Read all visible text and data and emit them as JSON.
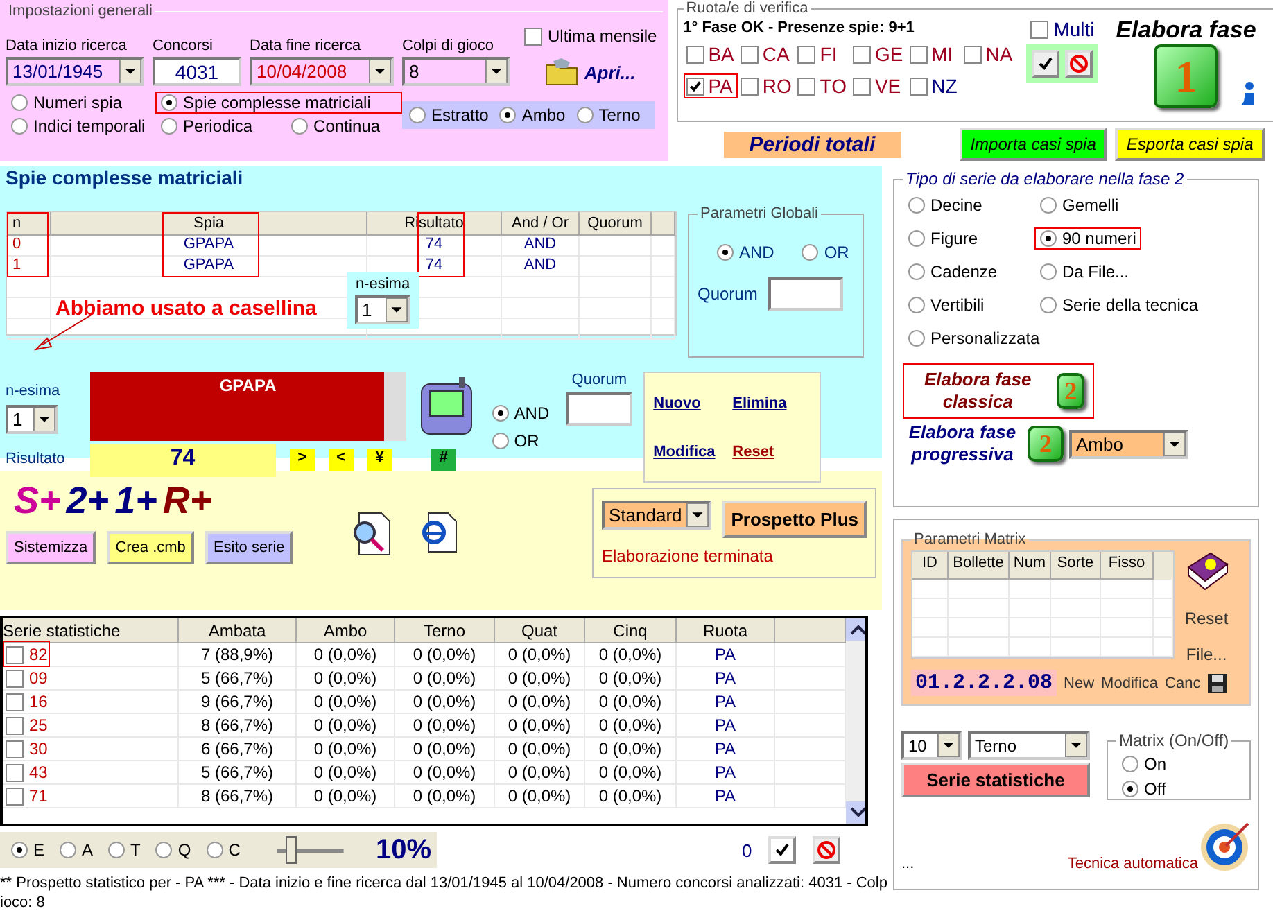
{
  "general": {
    "title": "Impostazioni generali",
    "fields": [
      {
        "label": "Data inizio ricerca",
        "value": "13/01/1945",
        "kind": "combo",
        "color": "#000080"
      },
      {
        "label": "Concorsi",
        "value": "4031",
        "kind": "text",
        "color": "#000080"
      },
      {
        "label": "Data fine ricerca",
        "value": "10/04/2008",
        "kind": "combo",
        "color": "#cc0000"
      },
      {
        "label": "Colpi di gioco",
        "value": "8",
        "kind": "combo",
        "color": "#000000"
      }
    ],
    "ultima_mensile": {
      "label": "Ultima mensile",
      "checked": false
    },
    "open_button": "Apri...",
    "modes": [
      {
        "label": "Numeri spia",
        "selected": false,
        "highlighted": false
      },
      {
        "label": "Spie complesse matriciali",
        "selected": true,
        "highlighted": true
      },
      {
        "label": "Indici temporali",
        "selected": false,
        "highlighted": false
      },
      {
        "label": "Periodica",
        "selected": false,
        "highlighted": false
      },
      {
        "label": "Continua",
        "selected": false,
        "highlighted": false
      }
    ],
    "sorte": [
      {
        "label": "Estratto",
        "selected": false
      },
      {
        "label": "Ambo",
        "selected": true
      },
      {
        "label": "Terno",
        "selected": false
      }
    ]
  },
  "verifica": {
    "title": "Ruota/e di verifica",
    "status": "1° Fase OK - Presenze spie: 9+1",
    "wheels": [
      {
        "label": "BA",
        "checked": false,
        "highlighted": false,
        "color": "#a00020"
      },
      {
        "label": "CA",
        "checked": false,
        "highlighted": false,
        "color": "#a00020"
      },
      {
        "label": "FI",
        "checked": false,
        "highlighted": false,
        "color": "#a00020"
      },
      {
        "label": "GE",
        "checked": false,
        "highlighted": false,
        "color": "#a00020"
      },
      {
        "label": "MI",
        "checked": false,
        "highlighted": false,
        "color": "#a00020"
      },
      {
        "label": "NA",
        "checked": false,
        "highlighted": false,
        "color": "#a00020"
      },
      {
        "label": "PA",
        "checked": true,
        "highlighted": true,
        "color": "#a00020"
      },
      {
        "label": "RO",
        "checked": false,
        "highlighted": false,
        "color": "#a00020"
      },
      {
        "label": "TO",
        "checked": false,
        "highlighted": false,
        "color": "#a00020"
      },
      {
        "label": "VE",
        "checked": false,
        "highlighted": false,
        "color": "#a00020"
      },
      {
        "label": "NZ",
        "checked": false,
        "highlighted": false,
        "color": "#000080"
      }
    ],
    "multi": {
      "label": "Multi",
      "checked": false
    }
  },
  "elabora_fase": {
    "title": "Elabora fase",
    "step": "1"
  },
  "periodi_totali": "Periodi totali",
  "importa": "Importa casi spia",
  "esporta": "Esporta casi spia",
  "spie": {
    "title": "Spie complesse matriciali",
    "columns": [
      {
        "label": "n",
        "highlighted": true
      },
      {
        "label": "Spia",
        "highlighted": true
      },
      {
        "label": "Risultato",
        "highlighted": true
      },
      {
        "label": "And / Or",
        "highlighted": false
      },
      {
        "label": "Quorum",
        "highlighted": false
      }
    ],
    "rows": [
      {
        "n": "0",
        "spia": "GPAPA",
        "risultato": "74",
        "and_or": "AND"
      },
      {
        "n": "1",
        "spia": "GPAPA",
        "risultato": "74",
        "and_or": "AND"
      }
    ],
    "table_nesima": {
      "label": "n-esima",
      "value": "1"
    },
    "annotation": "Abbiamo usato a casellina",
    "nesima": {
      "label": "n-esima",
      "value": "1"
    },
    "spia_value": "GPAPA",
    "risultato": {
      "label": "Risultato",
      "value": "74"
    },
    "nav_buttons": [
      ">",
      "<",
      "¥",
      "#"
    ],
    "logic": [
      {
        "label": "AND",
        "selected": true
      },
      {
        "label": "OR",
        "selected": false
      }
    ],
    "quorum_label": "Quorum",
    "globali": {
      "title": "Parametri Globali",
      "logic": [
        {
          "label": "AND",
          "selected": true
        },
        {
          "label": "OR",
          "selected": false
        }
      ],
      "quorum_label": "Quorum"
    },
    "links": [
      {
        "label": "Nuovo",
        "kind": "link"
      },
      {
        "label": "Elimina",
        "kind": "link"
      },
      {
        "label": "Modifica",
        "kind": "link"
      },
      {
        "label": "Reset",
        "kind": "danger"
      }
    ]
  },
  "tipo_serie": {
    "title": "Tipo di serie da elaborare nella fase 2",
    "options": [
      {
        "label": "Decine",
        "selected": false,
        "highlighted": false
      },
      {
        "label": "Gemelli",
        "selected": false,
        "highlighted": false
      },
      {
        "label": "Figure",
        "selected": false,
        "highlighted": false
      },
      {
        "label": "90 numeri",
        "selected": true,
        "highlighted": true
      },
      {
        "label": "Cadenze",
        "selected": false,
        "highlighted": false
      },
      {
        "label": "Da File...",
        "selected": false,
        "highlighted": false
      },
      {
        "label": "Vertibili",
        "selected": false,
        "highlighted": false
      },
      {
        "label": "Serie della tecnica",
        "selected": false,
        "highlighted": false
      },
      {
        "label": "Personalizzata",
        "selected": false,
        "highlighted": false
      }
    ],
    "classica": {
      "label": "Elabora fase classica",
      "step": "2",
      "highlighted": true
    },
    "progressiva": {
      "label": "Elabora fase progressiva",
      "step": "2",
      "sorte": "Ambo"
    }
  },
  "sistema": {
    "logo": [
      {
        "text": "S+",
        "color": "#cc0099"
      },
      {
        "text": "2+",
        "color": "#000080"
      },
      {
        "text": "1+",
        "color": "#000080"
      },
      {
        "text": "R+",
        "color": "#8b0000"
      }
    ],
    "buttons": [
      {
        "label": "Sistemizza",
        "color": "#ffc0ff"
      },
      {
        "label": "Crea .cmb",
        "color": "#ffff80"
      },
      {
        "label": "Esito serie",
        "color": "#c0c0ff"
      }
    ],
    "format": "Standard",
    "prospetto": "Prospetto Plus",
    "status": "Elaborazione terminata"
  },
  "serie": {
    "columns": [
      "Serie statistiche",
      "Ambata",
      "Ambo",
      "Terno",
      "Quat",
      "Cinq",
      "Ruota"
    ],
    "rows": [
      {
        "checked": false,
        "highlighted": true,
        "cells": [
          "82",
          "7 (88,9%)",
          "0 (0,0%)",
          "0 (0,0%)",
          "0 (0,0%)",
          "0 (0,0%)",
          "PA"
        ]
      },
      {
        "checked": false,
        "highlighted": false,
        "cells": [
          "09",
          "5 (66,7%)",
          "0 (0,0%)",
          "0 (0,0%)",
          "0 (0,0%)",
          "0 (0,0%)",
          "PA"
        ]
      },
      {
        "checked": false,
        "highlighted": false,
        "cells": [
          "16",
          "9 (66,7%)",
          "0 (0,0%)",
          "0 (0,0%)",
          "0 (0,0%)",
          "0 (0,0%)",
          "PA"
        ]
      },
      {
        "checked": false,
        "highlighted": false,
        "cells": [
          "25",
          "8 (66,7%)",
          "0 (0,0%)",
          "0 (0,0%)",
          "0 (0,0%)",
          "0 (0,0%)",
          "PA"
        ]
      },
      {
        "checked": false,
        "highlighted": false,
        "cells": [
          "30",
          "6 (66,7%)",
          "0 (0,0%)",
          "0 (0,0%)",
          "0 (0,0%)",
          "0 (0,0%)",
          "PA"
        ]
      },
      {
        "checked": false,
        "highlighted": false,
        "cells": [
          "43",
          "5 (66,7%)",
          "0 (0,0%)",
          "0 (0,0%)",
          "0 (0,0%)",
          "0 (0,0%)",
          "PA"
        ]
      },
      {
        "checked": false,
        "highlighted": false,
        "cells": [
          "71",
          "8 (66,7%)",
          "0 (0,0%)",
          "0 (0,0%)",
          "0 (0,0%)",
          "0 (0,0%)",
          "PA"
        ]
      }
    ],
    "filters": [
      {
        "label": "E",
        "selected": true
      },
      {
        "label": "A",
        "selected": false
      },
      {
        "label": "T",
        "selected": false
      },
      {
        "label": "Q",
        "selected": false
      },
      {
        "label": "C",
        "selected": false
      }
    ],
    "threshold": {
      "level": 0.2,
      "reading": "10%"
    },
    "count": "0"
  },
  "matrix": {
    "title": "Parametri Matrix",
    "columns": [
      "ID",
      "Bollette",
      "Num",
      "Sorte",
      "Fisso"
    ],
    "side_links": [
      "Reset",
      "File..."
    ],
    "code": "01.2.2.2.08",
    "actions": [
      "New",
      "Modifica",
      "Canc"
    ],
    "count": "10",
    "sorte": "Terno",
    "serie_button": "Serie statistiche",
    "switch": {
      "title": "Matrix (On/Off)",
      "options": [
        {
          "label": "On",
          "selected": false
        },
        {
          "label": "Off",
          "selected": true
        }
      ]
    },
    "dots": "...",
    "auto": "Tecnica automatica"
  },
  "footer": [
    "** Prospetto statistico per  - PA ***  - Data inizio e fine ricerca dal 13/01/1945 al 10/04/2008 - Numero concorsi analizzati: 4031 - Colp",
    "ioco: 8"
  ]
}
